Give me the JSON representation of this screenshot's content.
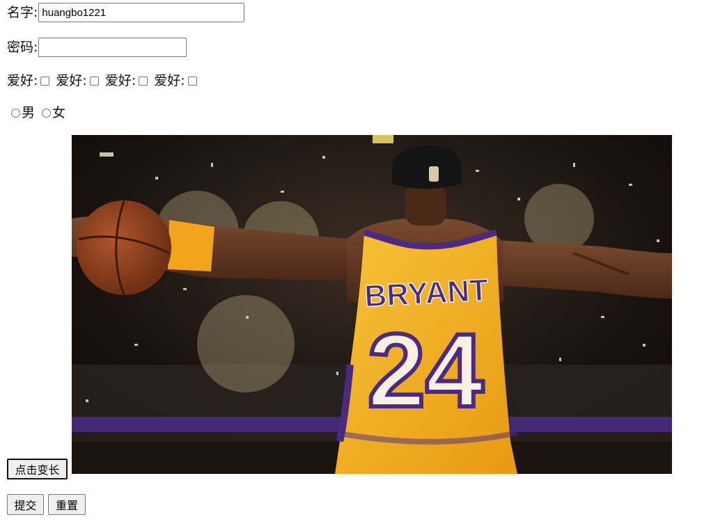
{
  "form": {
    "name_label": "名字:",
    "name_value": "huangbo1221",
    "password_label": "密码:",
    "password_value": "",
    "hobby_label": "爱好:",
    "hobbies": [
      {
        "label": "爱好:",
        "checked": false
      },
      {
        "label": "爱好:",
        "checked": false
      },
      {
        "label": "爱好:",
        "checked": false
      },
      {
        "label": "爱好:",
        "checked": false
      }
    ],
    "gender_options": [
      {
        "label": "男",
        "checked": false
      },
      {
        "label": "女",
        "checked": false
      }
    ],
    "grow_button": "点击变长",
    "submit_button": "提交",
    "reset_button": "重置"
  },
  "image": {
    "jersey_name": "BRYANT",
    "jersey_number": "24",
    "colors": {
      "jersey": "#f4b41a",
      "trim": "#4b2a82",
      "skin": "#5a3320",
      "background": "#1a1410"
    }
  }
}
